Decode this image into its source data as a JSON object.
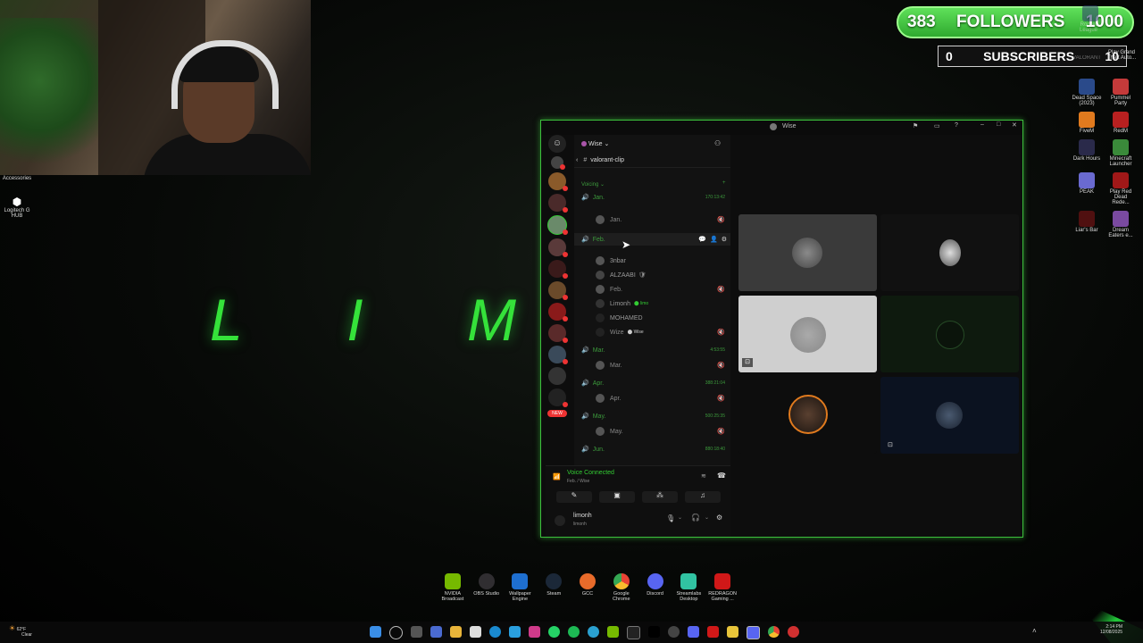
{
  "overlay": {
    "followers_count": "383",
    "followers_label": "FOLLOWERS",
    "followers_goal": "1000",
    "subscribers_count": "0",
    "subscribers_label": "SUBSCRIBERS",
    "subscribers_goal": "10"
  },
  "wallpaper_text": [
    "L",
    "I",
    "M"
  ],
  "desktop_left": [
    {
      "label": "Accessories"
    },
    {
      "label": "Logitech G HUB"
    }
  ],
  "desktop_right": [
    {
      "label": "Dead Space (2023)",
      "color": "#2a4a8a"
    },
    {
      "label": "Pummel Party",
      "color": "#c43a3a"
    },
    {
      "label": "FiveM",
      "color": "#e07a1e"
    },
    {
      "label": "RedM",
      "color": "#b82020"
    },
    {
      "label": "Dark Hours",
      "color": "#2a2a4a"
    },
    {
      "label": "Minecraft Launcher",
      "color": "#3a8a3a"
    },
    {
      "label": "PEAK",
      "color": "#6a6ad0"
    },
    {
      "label": "Play Red Dead Rede...",
      "color": "#a01818"
    },
    {
      "label": "Liar's Bar",
      "color": "#501010"
    },
    {
      "label": "Dream Eaters e...",
      "color": "#7a4aa0"
    }
  ],
  "desktop_top_right": [
    {
      "label": "Rocket League"
    },
    {
      "label": "Play Grand Theft Auto..."
    },
    {
      "label": "VALORANT"
    }
  ],
  "discord": {
    "window_title": "Wise",
    "server_name": "Wise",
    "channel_header": "valorant-clip",
    "category": "Voicing",
    "channels": [
      {
        "name": "Jan.",
        "time": "170:13:42",
        "members": [
          "Jan."
        ]
      },
      {
        "name": "Feb.",
        "time": "",
        "members": [
          "3nbar",
          "ALZAABI",
          "Feb.",
          "Limonh",
          "MOHAMED",
          "Wize"
        ]
      },
      {
        "name": "Mar.",
        "time": "4:53:55",
        "members": [
          "Mar."
        ]
      },
      {
        "name": "Apr.",
        "time": "388:21:04",
        "members": [
          "Apr."
        ]
      },
      {
        "name": "May.",
        "time": "500:25:35",
        "members": [
          "May."
        ]
      },
      {
        "name": "Jun.",
        "time": "880:18:40",
        "members": []
      }
    ],
    "limonh_tag": "limo",
    "wize_tag": "Wise",
    "alzaabi_suffix": "🛡",
    "new_badge": "NEW",
    "voice_status": "Voice Connected",
    "voice_location": "Feb. / Wise",
    "user_name": "limonh",
    "user_status": "limonh",
    "video_tiles": [
      {
        "label": "3nbar tile",
        "bg": "#3a3a3a"
      },
      {
        "label": "mask tile",
        "bg": "#111111"
      },
      {
        "label": "wave tile",
        "bg": "#cfcfcf"
      },
      {
        "label": "green tile",
        "bg": "#0e1a0e"
      },
      {
        "label": "orange ring tile",
        "bg": "#0d0d0d"
      },
      {
        "label": "blue tile",
        "bg": "#0b1220"
      }
    ]
  },
  "dock": [
    {
      "label": "NVIDIA Broadcast",
      "color": "#76b900"
    },
    {
      "label": "OBS Studio",
      "color": "#302e31"
    },
    {
      "label": "Wallpaper Engine",
      "color": "#1e6fd0"
    },
    {
      "label": "Steam",
      "color": "#1b2838"
    },
    {
      "label": "GCC",
      "color": "#e86b2a"
    },
    {
      "label": "Google Chrome",
      "color": "#e84335"
    },
    {
      "label": "Discord",
      "color": "#5865f2"
    },
    {
      "label": "Streamlabs Desktop",
      "color": "#31c3a2"
    },
    {
      "label": "REDRAGON Gaming ...",
      "color": "#d01818"
    }
  ],
  "taskbar": {
    "weather_temp": "62°F",
    "weather_text": "Clear",
    "time": "2:14 PM",
    "date": "12/08/2025"
  }
}
